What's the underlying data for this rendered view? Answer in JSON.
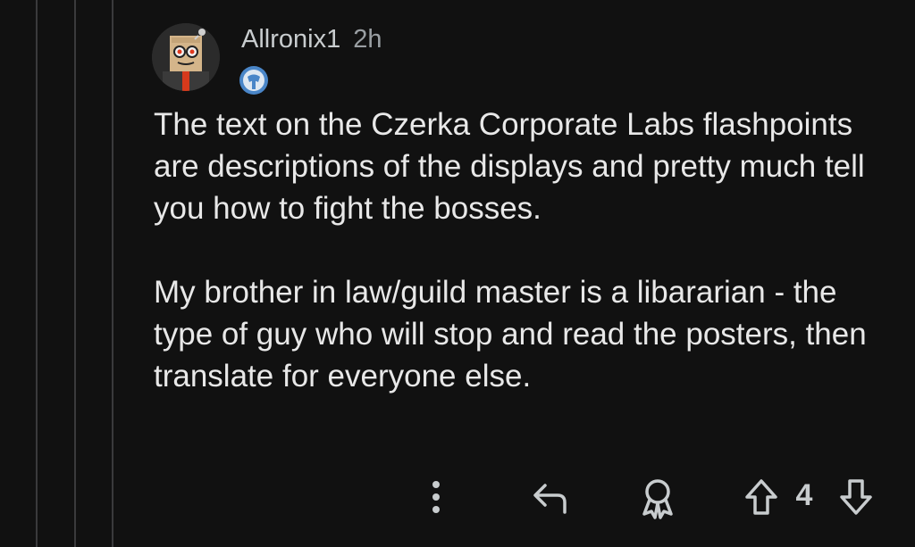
{
  "comment": {
    "author": "Allronix1",
    "time": "2h",
    "paragraphs": [
      "The text on the Czerka Corporate Labs flashpoints are descriptions of the displays and pretty much tell you how to fight the bosses.",
      "My brother in law/guild master is a libararian - the type of guy who will stop and read the posters, then translate for everyone else."
    ],
    "score": "4"
  },
  "icons": {
    "more": "more-vertical-icon",
    "reply": "reply-arrow-icon",
    "award": "award-ribbon-icon",
    "upvote": "upvote-arrow-icon",
    "downvote": "downvote-arrow-icon",
    "flair": "flair-badge-icon"
  },
  "colors": {
    "background": "#111111",
    "text": "#e8e8e8",
    "muted": "#9a9fa3",
    "thread_line": "#3a3a3c",
    "flair": "#4a86c8"
  }
}
